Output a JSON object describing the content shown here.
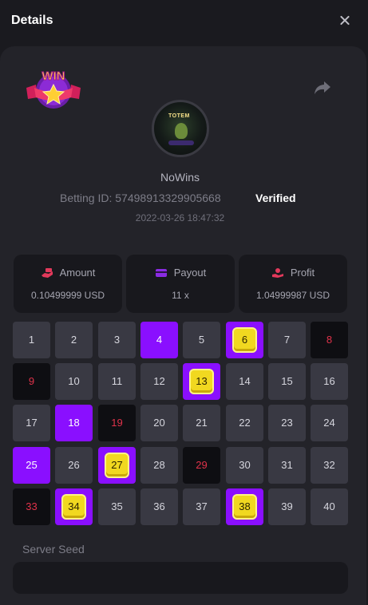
{
  "header": {
    "title": "Details"
  },
  "game": {
    "badge_text": "WIN",
    "username": "NoWins",
    "betting_label": "Betting ID:",
    "betting_id": "5749891332990566​8",
    "verified": "Verified",
    "datetime": "2022-03-26 18:47:32"
  },
  "stats": [
    {
      "label": "Amount",
      "value": "0.10499999 USD",
      "icon": "money-hand-icon"
    },
    {
      "label": "Payout",
      "value": "11 x",
      "icon": "wallet-card-icon"
    },
    {
      "label": "Profit",
      "value": "1.04999987 USD",
      "icon": "profit-hand-icon"
    }
  ],
  "grid": {
    "numbers": [
      "1",
      "2",
      "3",
      "4",
      "5",
      "6",
      "7",
      "8",
      "9",
      "10",
      "11",
      "12",
      "13",
      "14",
      "15",
      "16",
      "17",
      "18",
      "19",
      "20",
      "21",
      "22",
      "23",
      "24",
      "25",
      "26",
      "27",
      "28",
      "29",
      "30",
      "31",
      "32",
      "33",
      "34",
      "35",
      "36",
      "37",
      "38",
      "39",
      "40"
    ],
    "picked": [
      4,
      6,
      13,
      18,
      25,
      27,
      34,
      38
    ],
    "drawn": [
      8,
      9,
      19,
      29,
      33
    ],
    "hits": [
      6,
      13,
      27,
      34,
      38
    ]
  },
  "server_seed": {
    "label": "Server Seed"
  },
  "colors": {
    "accent": "#8a0fff",
    "miss": "#e0324a",
    "hit_gem": "#f1d820",
    "panel": "#232329"
  }
}
